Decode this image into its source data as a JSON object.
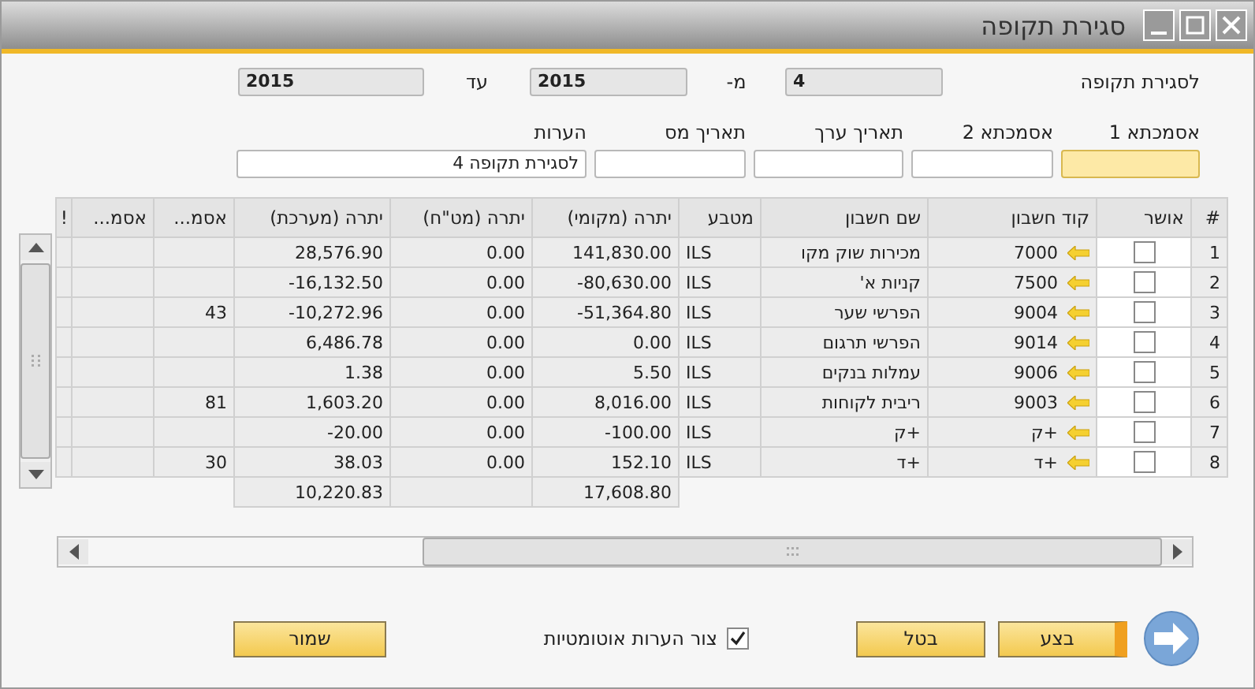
{
  "window": {
    "title": "סגירת תקופה"
  },
  "period": {
    "label": "לסגירת תקופה",
    "from_period": "4",
    "from_label": "מ-",
    "from_year": "2015",
    "to_label": "עד",
    "to_year": "2015"
  },
  "fields": [
    {
      "label": "אסמכתא 1",
      "focused": true
    },
    {
      "label": "אסמכתא 2",
      "focused": false
    },
    {
      "label": "תאריך ערך",
      "focused": false
    },
    {
      "label": "תאריך מס",
      "focused": false
    },
    {
      "label": "הערות",
      "value": "לסגירת תקופה 4",
      "focused": false
    }
  ],
  "table": {
    "columns": [
      "#",
      "אושר",
      "קוד חשבון",
      "שם חשבון",
      "מטבע",
      "יתרה (מקומי)",
      "יתרה (מט\"ח)",
      "יתרה (מערכת)",
      "אסמ...",
      "אסמ...",
      "!"
    ],
    "rows": [
      {
        "number": "1",
        "approved": false,
        "account_code": "7000",
        "account_name": "מכירות שוק מקו",
        "currency": "ILS",
        "balance_local": "141,830.00",
        "balance_fc": "0.00",
        "balance_system": "28,576.90"
      },
      {
        "number": "2",
        "approved": false,
        "account_code": "7500",
        "account_name": "קניות א'",
        "currency": "ILS",
        "balance_local": "-80,630.00",
        "balance_fc": "0.00",
        "balance_system": "-16,132.50"
      },
      {
        "number": "3",
        "approved": false,
        "account_code": "9004",
        "account_name": "הפרשי שער",
        "currency": "ILS",
        "balance_local": "-51,364.80",
        "balance_fc": "0.00",
        "balance_system": "-10,272.96",
        "ref_1": "43"
      },
      {
        "number": "4",
        "approved": false,
        "account_code": "9014",
        "account_name": "הפרשי תרגום",
        "currency": "ILS",
        "balance_local": "0.00",
        "balance_fc": "0.00",
        "balance_system": "6,486.78"
      },
      {
        "number": "5",
        "approved": false,
        "account_code": "9006",
        "account_name": "עמלות בנקים",
        "currency": "ILS",
        "balance_local": "5.50",
        "balance_fc": "0.00",
        "balance_system": "1.38"
      },
      {
        "number": "6",
        "approved": false,
        "account_code": "9003",
        "account_name": "ריבית לקוחות",
        "currency": "ILS",
        "balance_local": "8,016.00",
        "balance_fc": "0.00",
        "balance_system": "1,603.20",
        "ref_1": "81"
      },
      {
        "number": "7",
        "approved": false,
        "account_code": "+ק",
        "account_name": "+ק",
        "currency": "ILS",
        "balance_local": "-100.00",
        "balance_fc": "0.00",
        "balance_system": "-20.00"
      },
      {
        "number": "8",
        "approved": false,
        "account_code": "+ד",
        "account_name": "+ד",
        "currency": "ILS",
        "balance_local": "152.10",
        "balance_fc": "0.00",
        "balance_system": "38.03",
        "ref_1": "30"
      }
    ],
    "totals": {
      "balance_local": "17,608.80",
      "balance_system": "10,220.83"
    }
  },
  "buttons": [
    {
      "label": "בצע",
      "kind": "primary"
    },
    {
      "label": "בטל",
      "kind": "normal"
    }
  ],
  "auto_notes": {
    "label": "צור הערות אוטומטיות",
    "checked": true
  },
  "save_button": {
    "label": "שמור"
  }
}
